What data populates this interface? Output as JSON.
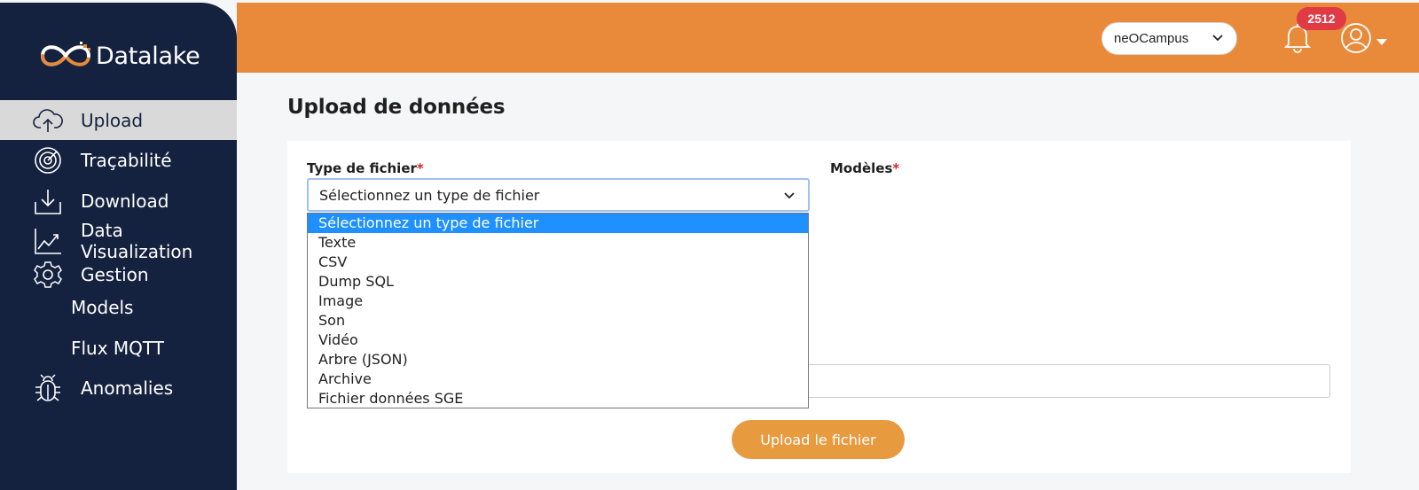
{
  "app": {
    "name": "Datalake"
  },
  "sidebar": {
    "items": [
      {
        "label": "Upload",
        "icon": "cloud-upload-icon",
        "active": true
      },
      {
        "label": "Traçabilité",
        "icon": "target-icon"
      },
      {
        "label": "Download",
        "icon": "download-icon"
      },
      {
        "label": "Data Visualization",
        "icon": "chart-icon"
      },
      {
        "label": "Gestion",
        "icon": "gear-icon"
      }
    ],
    "sub_items": [
      {
        "label": "Models"
      },
      {
        "label": "Flux MQTT"
      }
    ],
    "anomalies": {
      "label": "Anomalies",
      "icon": "bug-icon"
    }
  },
  "header": {
    "campus_select": {
      "value": "neOCampus",
      "icon": "chevron-down-icon"
    },
    "notifications": {
      "count": "2512",
      "icon": "bell-icon"
    },
    "user": {
      "icon": "user-circle-icon"
    }
  },
  "main": {
    "title": "Upload de données",
    "file_type": {
      "label": "Type de fichier",
      "required_mark": "*",
      "selected": "Sélectionnez un type de fichier",
      "options": [
        "Sélectionnez un type de fichier",
        "Texte",
        "CSV",
        "Dump SQL",
        "Image",
        "Son",
        "Vidéo",
        "Arbre (JSON)",
        "Archive",
        "Fichier données SGE"
      ]
    },
    "models": {
      "label": "Modèles",
      "required_mark": "*"
    },
    "upload_button": "Upload le fichier"
  },
  "colors": {
    "sidebar": "#15223f",
    "topbar": "#e98a3b",
    "accent_button": "#e89a3f",
    "badge": "#e03a45",
    "selected_option": "#1e90ff"
  }
}
